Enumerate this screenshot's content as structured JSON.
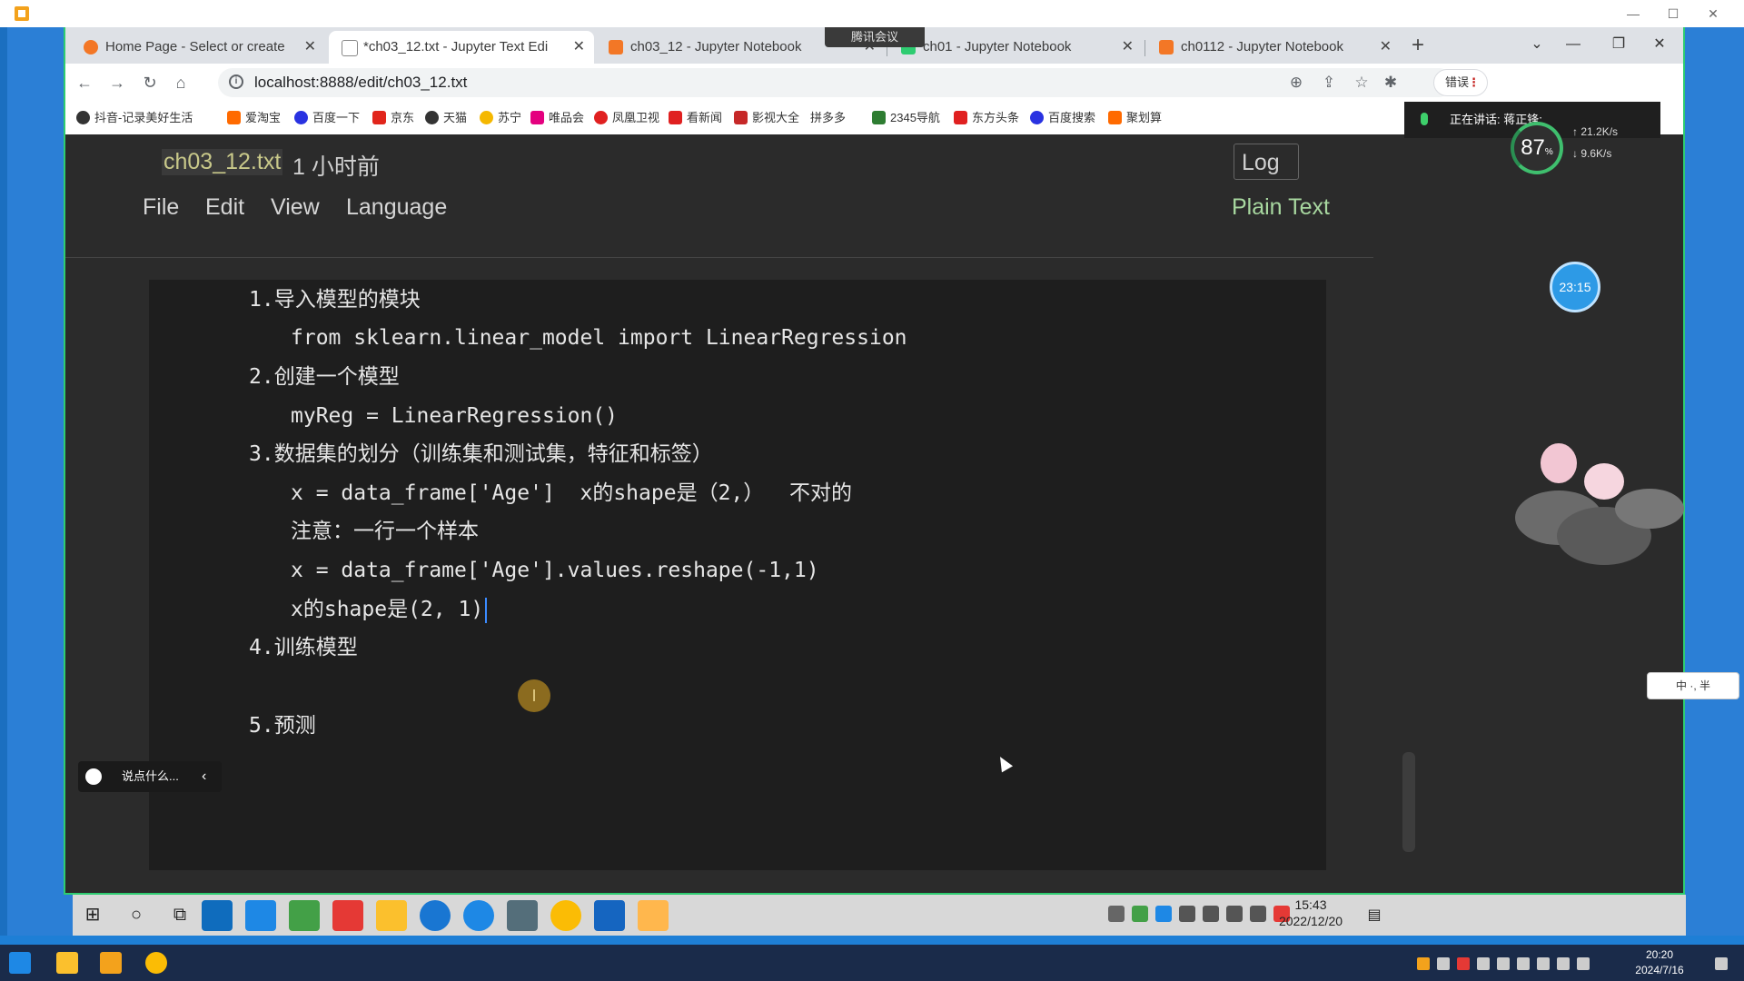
{
  "browser": {
    "tabs": [
      {
        "label": "Home Page - Select or create",
        "icon_color": "#f37726",
        "active": false
      },
      {
        "label": "*ch03_12.txt - Jupyter Text Edi",
        "icon_color": "#cccccc",
        "active": true
      },
      {
        "label": "ch03_12 - Jupyter Notebook",
        "icon_color": "#f37726",
        "active": false
      },
      {
        "label": "ch01 - Jupyter Notebook",
        "icon_color": "#f37726",
        "active": false
      },
      {
        "label": "ch0112 - Jupyter Notebook",
        "icon_color": "#f37726",
        "active": false
      }
    ],
    "meeting_badge": "腾讯会议",
    "url": "localhost:8888/edit/ch03_12.txt",
    "error_button": "错误",
    "bookmarks": [
      "抖音-记录美好生活",
      "爱淘宝",
      "百度一下",
      "京东",
      "天猫",
      "苏宁",
      "唯品会",
      "凤凰卫视",
      "看新闻",
      "影视大全",
      "拼多多",
      "2345导航",
      "东方头条",
      "百度搜索",
      "聚划算"
    ],
    "speaking": "正在讲话: 蒋正锋;"
  },
  "jupyter": {
    "filename": "ch03_12.txt",
    "saved": "1 小时前",
    "logout": "Log",
    "language": "Plain Text",
    "menu": [
      "File",
      "Edit",
      "View",
      "Language"
    ],
    "lines": [
      {
        "text": "1.导入模型的模块",
        "indent": false
      },
      {
        "text": "from sklearn.linear_model import LinearRegression",
        "indent": true
      },
      {
        "text": "2.创建一个模型",
        "indent": false
      },
      {
        "text": "myReg = LinearRegression()",
        "indent": true
      },
      {
        "text": "3.数据集的划分（训练集和测试集，特征和标签）",
        "indent": false
      },
      {
        "text": "x = data_frame['Age']  x的shape是（2,）  不对的",
        "indent": true
      },
      {
        "text": "注意：一行一个样本",
        "indent": true
      },
      {
        "text": "x = data_frame['Age'].values.reshape(-1,1)",
        "indent": true
      },
      {
        "text": "x的shape是(2, 1)",
        "indent": true,
        "cursor": true
      },
      {
        "text": "4.训练模型",
        "indent": false
      },
      {
        "text": "",
        "indent": false
      },
      {
        "text": "5.预测",
        "indent": false
      }
    ]
  },
  "overlays": {
    "speed_percent": "87",
    "speed_unit": "%",
    "upload": "↑ 21.2K/s",
    "download": "↓ 9.6K/s",
    "timer": "23:15",
    "ime": "中 ·, 半",
    "chat_placeholder": "说点什么..."
  },
  "inner_taskbar": {
    "time": "15:43",
    "date": "2022/12/20"
  },
  "outer_taskbar": {
    "time": "20:20",
    "date": "2024/7/16"
  },
  "colors": {
    "editor_bg": "#1e1e1e",
    "page_bg": "#2b2b2b",
    "accent_green": "#2ecc71",
    "cursor_blue": "#3b8bff"
  }
}
